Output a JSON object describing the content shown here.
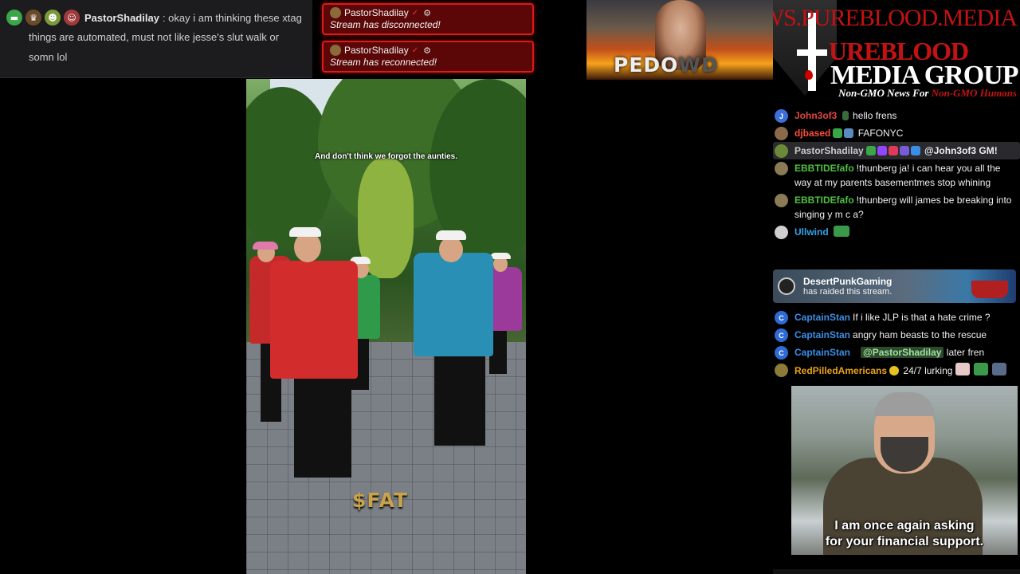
{
  "top_left_chat": {
    "user": "PastorShadilay",
    "message_line1": ": okay i am thinking these xtag",
    "message_line2": "things are automated, must not like jesse's slut walk or",
    "message_line3": "somn lol",
    "badge_icons": [
      "green-shield-icon",
      "crown-icon",
      "pepe-icon",
      "santa-hat-icon"
    ]
  },
  "alerts": [
    {
      "user": "PastorShadilay",
      "text": "Stream has disconnected!"
    },
    {
      "user": "PastorShadilay",
      "text": "Stream has reconnected!"
    }
  ],
  "banner": {
    "word_a": "PEDO",
    "word_b": "W",
    "word_c": "D"
  },
  "logo": {
    "url": "NEWS.PUREBLOOD.MEDIA",
    "line1": "UREBLOOD",
    "line2": "MEDIA GROUP",
    "tagline_a": "Non-GMO News For ",
    "tagline_b": "Non-GMO Humans"
  },
  "video": {
    "caption": "And don't think we forgot the aunties.",
    "ticker": "$FAT"
  },
  "chat": [
    {
      "user": "John3of3",
      "color": "#e2463f",
      "avatar_color": "#3b6fd9",
      "avatar": "J",
      "text": "hello frens"
    },
    {
      "user": "djbased",
      "color": "#ff4c3b",
      "avatar_color": "#8a6a4a",
      "avatar": "",
      "text": "FAFONYC"
    },
    {
      "user": "PastorShadilay",
      "color": "#c9c9c9",
      "avatar_color": "#6a8a3a",
      "avatar": "",
      "text": "@John3of3 GM!"
    },
    {
      "user": "EBBTIDEfafo",
      "color": "#4fc23f",
      "avatar_color": "#8a7a55",
      "avatar": "",
      "text": "!thunberg ja! i can hear you all the way at my parents basementmes stop whining"
    },
    {
      "user": "EBBTIDEfafo",
      "color": "#4fc23f",
      "avatar_color": "#8a7a55",
      "avatar": "",
      "text": "!thunberg will james be breaking into singing y m c a?"
    },
    {
      "user": "Ullwind",
      "color": "#2fa3e8",
      "avatar_color": "#cfcfcf",
      "avatar": "",
      "text": ""
    }
  ],
  "raid": {
    "user": "DesertPunkGaming",
    "text": "has raided this stream."
  },
  "chat2": [
    {
      "user": "CaptainStan",
      "color": "#3a8ee6",
      "avatar_color": "#2f6bd6",
      "avatar": "C",
      "text": "If i like JLP is that a hate crime ?"
    },
    {
      "user": "CaptainStan",
      "color": "#3a8ee6",
      "avatar_color": "#2f6bd6",
      "avatar": "C",
      "text": "angry ham beasts to the rescue"
    },
    {
      "user": "CaptainStan",
      "color": "#3a8ee6",
      "avatar_color": "#2f6bd6",
      "avatar": "C",
      "mention": "@PastorShadilay",
      "text": "later fren"
    },
    {
      "user": "RedPilledAmericans",
      "color": "#e8a21c",
      "avatar_color": "#8c7a3a",
      "avatar": "",
      "text": "24/7 lurking"
    }
  ],
  "video2": {
    "subtitle_line1": "I am once again asking",
    "subtitle_line2": "for your financial support."
  }
}
